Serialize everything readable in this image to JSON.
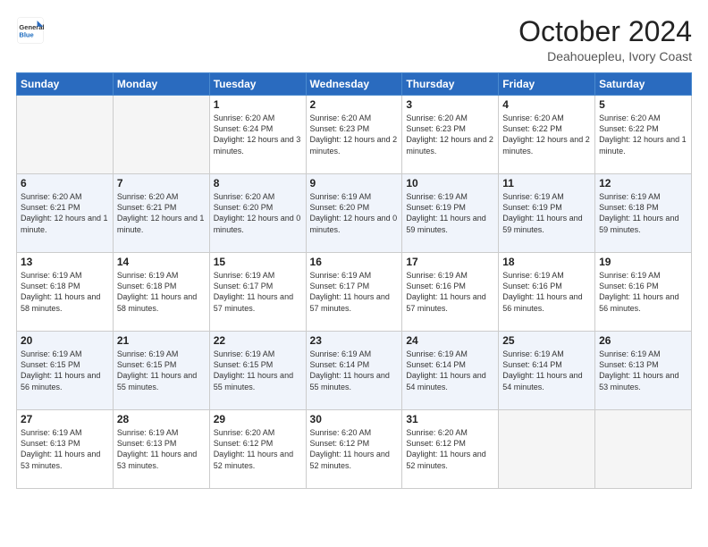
{
  "logo": {
    "line1": "General",
    "line2": "Blue"
  },
  "title": "October 2024",
  "subtitle": "Deahouepleu, Ivory Coast",
  "weekdays": [
    "Sunday",
    "Monday",
    "Tuesday",
    "Wednesday",
    "Thursday",
    "Friday",
    "Saturday"
  ],
  "weeks": [
    [
      {
        "day": "",
        "text": ""
      },
      {
        "day": "",
        "text": ""
      },
      {
        "day": "1",
        "text": "Sunrise: 6:20 AM\nSunset: 6:24 PM\nDaylight: 12 hours and 3 minutes."
      },
      {
        "day": "2",
        "text": "Sunrise: 6:20 AM\nSunset: 6:23 PM\nDaylight: 12 hours and 2 minutes."
      },
      {
        "day": "3",
        "text": "Sunrise: 6:20 AM\nSunset: 6:23 PM\nDaylight: 12 hours and 2 minutes."
      },
      {
        "day": "4",
        "text": "Sunrise: 6:20 AM\nSunset: 6:22 PM\nDaylight: 12 hours and 2 minutes."
      },
      {
        "day": "5",
        "text": "Sunrise: 6:20 AM\nSunset: 6:22 PM\nDaylight: 12 hours and 1 minute."
      }
    ],
    [
      {
        "day": "6",
        "text": "Sunrise: 6:20 AM\nSunset: 6:21 PM\nDaylight: 12 hours and 1 minute."
      },
      {
        "day": "7",
        "text": "Sunrise: 6:20 AM\nSunset: 6:21 PM\nDaylight: 12 hours and 1 minute."
      },
      {
        "day": "8",
        "text": "Sunrise: 6:20 AM\nSunset: 6:20 PM\nDaylight: 12 hours and 0 minutes."
      },
      {
        "day": "9",
        "text": "Sunrise: 6:19 AM\nSunset: 6:20 PM\nDaylight: 12 hours and 0 minutes."
      },
      {
        "day": "10",
        "text": "Sunrise: 6:19 AM\nSunset: 6:19 PM\nDaylight: 11 hours and 59 minutes."
      },
      {
        "day": "11",
        "text": "Sunrise: 6:19 AM\nSunset: 6:19 PM\nDaylight: 11 hours and 59 minutes."
      },
      {
        "day": "12",
        "text": "Sunrise: 6:19 AM\nSunset: 6:18 PM\nDaylight: 11 hours and 59 minutes."
      }
    ],
    [
      {
        "day": "13",
        "text": "Sunrise: 6:19 AM\nSunset: 6:18 PM\nDaylight: 11 hours and 58 minutes."
      },
      {
        "day": "14",
        "text": "Sunrise: 6:19 AM\nSunset: 6:18 PM\nDaylight: 11 hours and 58 minutes."
      },
      {
        "day": "15",
        "text": "Sunrise: 6:19 AM\nSunset: 6:17 PM\nDaylight: 11 hours and 57 minutes."
      },
      {
        "day": "16",
        "text": "Sunrise: 6:19 AM\nSunset: 6:17 PM\nDaylight: 11 hours and 57 minutes."
      },
      {
        "day": "17",
        "text": "Sunrise: 6:19 AM\nSunset: 6:16 PM\nDaylight: 11 hours and 57 minutes."
      },
      {
        "day": "18",
        "text": "Sunrise: 6:19 AM\nSunset: 6:16 PM\nDaylight: 11 hours and 56 minutes."
      },
      {
        "day": "19",
        "text": "Sunrise: 6:19 AM\nSunset: 6:16 PM\nDaylight: 11 hours and 56 minutes."
      }
    ],
    [
      {
        "day": "20",
        "text": "Sunrise: 6:19 AM\nSunset: 6:15 PM\nDaylight: 11 hours and 56 minutes."
      },
      {
        "day": "21",
        "text": "Sunrise: 6:19 AM\nSunset: 6:15 PM\nDaylight: 11 hours and 55 minutes."
      },
      {
        "day": "22",
        "text": "Sunrise: 6:19 AM\nSunset: 6:15 PM\nDaylight: 11 hours and 55 minutes."
      },
      {
        "day": "23",
        "text": "Sunrise: 6:19 AM\nSunset: 6:14 PM\nDaylight: 11 hours and 55 minutes."
      },
      {
        "day": "24",
        "text": "Sunrise: 6:19 AM\nSunset: 6:14 PM\nDaylight: 11 hours and 54 minutes."
      },
      {
        "day": "25",
        "text": "Sunrise: 6:19 AM\nSunset: 6:14 PM\nDaylight: 11 hours and 54 minutes."
      },
      {
        "day": "26",
        "text": "Sunrise: 6:19 AM\nSunset: 6:13 PM\nDaylight: 11 hours and 53 minutes."
      }
    ],
    [
      {
        "day": "27",
        "text": "Sunrise: 6:19 AM\nSunset: 6:13 PM\nDaylight: 11 hours and 53 minutes."
      },
      {
        "day": "28",
        "text": "Sunrise: 6:19 AM\nSunset: 6:13 PM\nDaylight: 11 hours and 53 minutes."
      },
      {
        "day": "29",
        "text": "Sunrise: 6:20 AM\nSunset: 6:12 PM\nDaylight: 11 hours and 52 minutes."
      },
      {
        "day": "30",
        "text": "Sunrise: 6:20 AM\nSunset: 6:12 PM\nDaylight: 11 hours and 52 minutes."
      },
      {
        "day": "31",
        "text": "Sunrise: 6:20 AM\nSunset: 6:12 PM\nDaylight: 11 hours and 52 minutes."
      },
      {
        "day": "",
        "text": ""
      },
      {
        "day": "",
        "text": ""
      }
    ]
  ]
}
